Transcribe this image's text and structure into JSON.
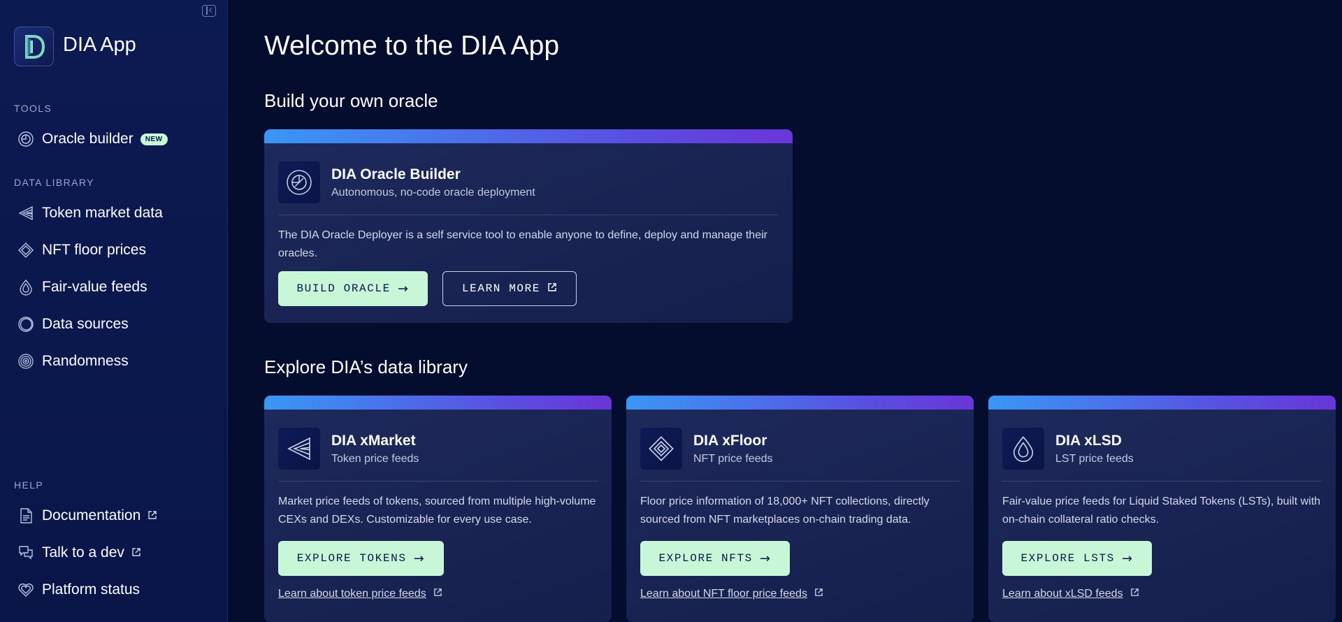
{
  "sidebar": {
    "app_title": "DIA App",
    "tools_label": "TOOLS",
    "tools": [
      {
        "label": "Oracle builder",
        "badge": "NEW"
      }
    ],
    "data_library_label": "DATA LIBRARY",
    "data_library": [
      {
        "label": "Token market data"
      },
      {
        "label": "NFT floor prices"
      },
      {
        "label": "Fair-value feeds"
      },
      {
        "label": "Data sources"
      },
      {
        "label": "Randomness"
      }
    ],
    "help_label": "HELP",
    "help": [
      {
        "label": "Documentation"
      },
      {
        "label": "Talk to a dev"
      },
      {
        "label": "Platform status"
      }
    ]
  },
  "main": {
    "page_title": "Welcome to the DIA App",
    "build_section_title": "Build your own oracle",
    "oracle_card": {
      "title": "DIA Oracle Builder",
      "subtitle": "Autonomous, no-code oracle deployment",
      "description": "The DIA Oracle Deployer is a self service tool to enable anyone to define, deploy and manage their oracles.",
      "primary_button": "BUILD ORACLE",
      "secondary_button": "LEARN MORE"
    },
    "explore_section_title": "Explore DIA’s data library",
    "library_cards": [
      {
        "title": "DIA xMarket",
        "subtitle": "Token price feeds",
        "description": "Market price feeds of tokens, sourced from multiple high-volume CEXs and DEXs. Customizable for every use case.",
        "button": "EXPLORE TOKENS",
        "link": "Learn about token price feeds"
      },
      {
        "title": "DIA xFloor",
        "subtitle": "NFT price feeds",
        "description": "Floor price information of 18,000+ NFT collections, directly sourced from NFT marketplaces on-chain trading data.",
        "button": "EXPLORE NFTS",
        "link": "Learn about NFT floor price feeds"
      },
      {
        "title": "DIA xLSD",
        "subtitle": "LST price feeds",
        "description": "Fair-value price feeds for Liquid Staked Tokens (LSTs), built with on-chain collateral ratio checks.",
        "button": "EXPLORE LSTS",
        "link": "Learn about xLSD feeds"
      }
    ]
  },
  "colors": {
    "background": "#050d2e",
    "sidebar": "#0c1a52",
    "accent_green": "#c8f7d8",
    "gradient_start": "#3a97f5",
    "gradient_end": "#6a35d8"
  },
  "icons": {
    "collapse": "sidebar-collapse-icon",
    "logo": "dia-logo-icon",
    "oracle_builder": "oracle-rings-icon",
    "token_market": "triangle-prism-icon",
    "nft_floor": "diamond-icon",
    "fair_value": "droplet-icon",
    "data_sources": "circle-ring-icon",
    "randomness": "fingerprint-icon",
    "documentation": "document-icon",
    "talk_to_dev": "chat-bubbles-icon",
    "platform_status": "heart-pulse-icon",
    "external": "external-link-icon",
    "arrow": "arrow-right-icon"
  }
}
